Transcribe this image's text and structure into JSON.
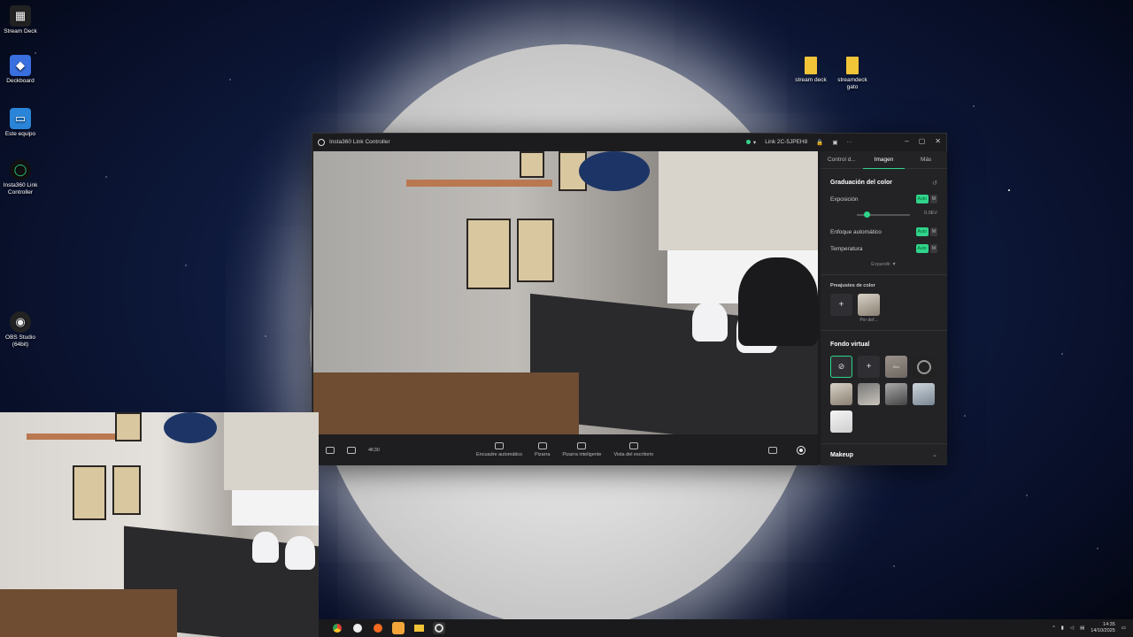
{
  "desktop": {
    "icons": [
      {
        "label": "Stream Deck"
      },
      {
        "label": "Deckboard"
      },
      {
        "label": "Este equipo"
      },
      {
        "label": "Insta360 Link Controller"
      },
      {
        "label": "OBS Studio (64bit)"
      }
    ],
    "folders": [
      {
        "label": "stream deck"
      },
      {
        "label": "streamdeck gato"
      }
    ]
  },
  "window": {
    "title": "Insta360 Link Controller",
    "device": "Link 2C-5JPEH8"
  },
  "panel": {
    "tabs": [
      {
        "label": "Control d..."
      },
      {
        "label": "Imagen"
      },
      {
        "label": "Más"
      }
    ],
    "active_tab": "Imagen",
    "color_grading": {
      "title": "Graduación del color",
      "exposure_label": "Exposición",
      "exposure_value": "0.0EV",
      "autofocus_label": "Enfoque automático",
      "temperature_label": "Temperatura",
      "auto_label": "Auto",
      "manual_label": "M",
      "expand_label": "Expandir ▼"
    },
    "presets": {
      "title": "Preajustes de color",
      "default_label": "Por def..."
    },
    "virtual_bg": {
      "title": "Fondo virtual",
      "blur_label": "Blur"
    },
    "makeup": {
      "title": "Makeup"
    }
  },
  "video_toolbar": {
    "resolution": "4K30",
    "tools": [
      {
        "label": "Encuadre automático"
      },
      {
        "label": "Pizarra"
      },
      {
        "label": "Pizarra inteligente"
      },
      {
        "label": "Vista del escritorio"
      }
    ]
  },
  "taskbar": {
    "time": "14:35",
    "date": "14/10/2025"
  },
  "colors": {
    "accent": "#30d48b",
    "panel_bg": "#232326",
    "window_bg": "#1c1c1f"
  }
}
